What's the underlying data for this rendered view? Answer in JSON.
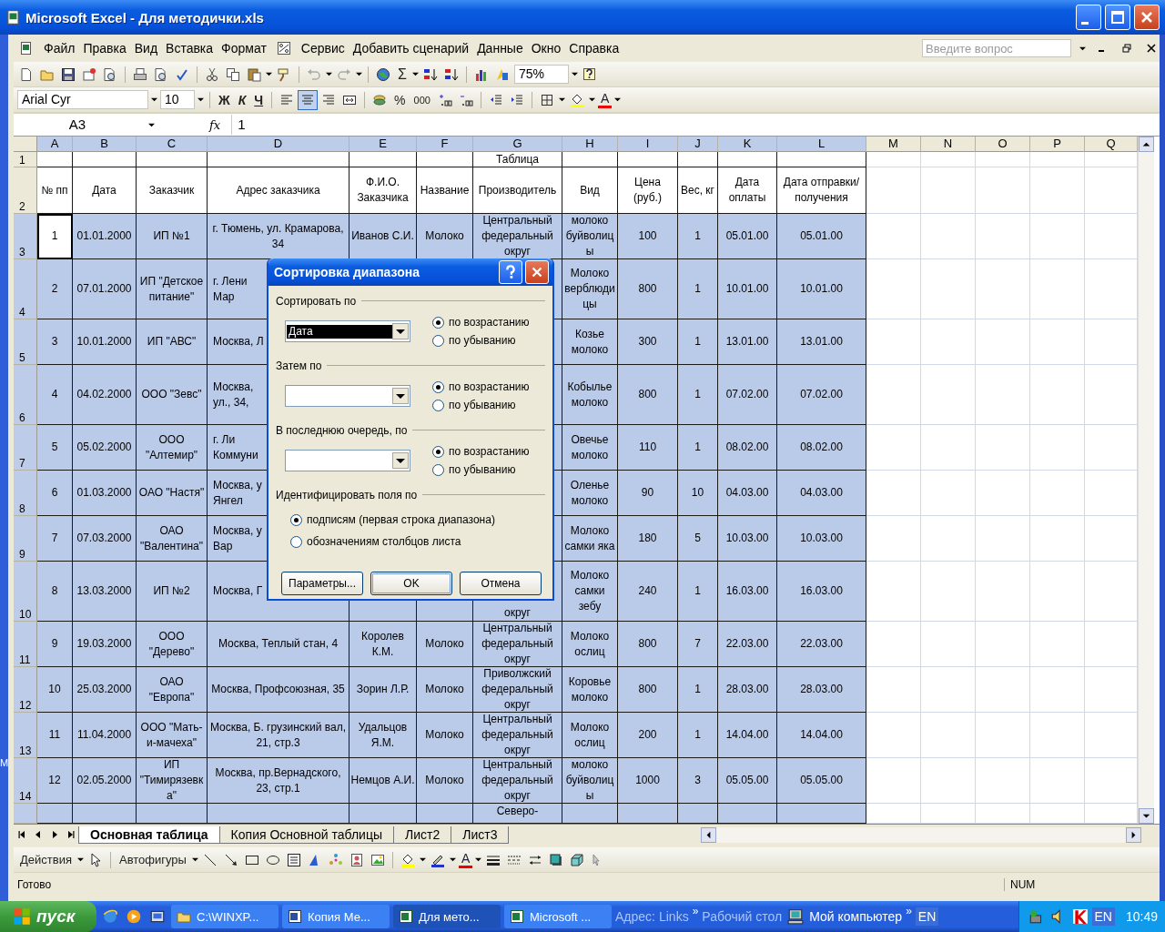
{
  "window": {
    "title": "Microsoft Excel - Для методички.xls"
  },
  "menu": [
    {
      "label": "Файл"
    },
    {
      "label": "Правка"
    },
    {
      "label": "Вид"
    },
    {
      "label": "Вставка"
    },
    {
      "label": "Формат"
    },
    {
      "label": "Сервис",
      "kind": "icon"
    },
    {
      "label": "Добавить сценарий"
    },
    {
      "label": "Данные"
    },
    {
      "label": "Окно"
    },
    {
      "label": "Справка"
    }
  ],
  "help_search": {
    "placeholder": "Введите вопрос"
  },
  "standard_toolbar": {
    "sum": "Σ",
    "zoom": "75%"
  },
  "format_toolbar": {
    "font": "Arial Cyr",
    "size": "10",
    "styles": [
      "Ж",
      "К",
      "Ч"
    ],
    "alignment": [
      {
        "kind": "left",
        "selected": false
      },
      {
        "kind": "center",
        "selected": true
      },
      {
        "kind": "right",
        "selected": false
      },
      {
        "kind": "merge",
        "selected": false
      }
    ],
    "percent": "%",
    "thousands": "000",
    "font_color": "A"
  },
  "formula_bar": {
    "name_box": "A3",
    "fx": "fx",
    "value": "1"
  },
  "sheet": {
    "columns": [
      {
        "label": "A",
        "selected": true
      },
      {
        "label": "B",
        "selected": true
      },
      {
        "label": "C",
        "selected": true
      },
      {
        "label": "D",
        "selected": true
      },
      {
        "label": "E",
        "selected": true
      },
      {
        "label": "F",
        "selected": true
      },
      {
        "label": "G",
        "selected": true
      },
      {
        "label": "H",
        "selected": true
      },
      {
        "label": "I",
        "selected": true
      },
      {
        "label": "J",
        "selected": true
      },
      {
        "label": "K",
        "selected": true
      },
      {
        "label": "L",
        "selected": true
      },
      {
        "label": "M",
        "selected": false
      },
      {
        "label": "N",
        "selected": false
      },
      {
        "label": "O",
        "selected": false
      },
      {
        "label": "P",
        "selected": false
      },
      {
        "label": "Q",
        "selected": false
      }
    ],
    "rows": [
      {
        "number": "1",
        "selected": false,
        "active": false,
        "cells": {
          "g": "Таблица"
        }
      },
      {
        "number": "2",
        "selected": false,
        "active": false,
        "cells": {
          "a": "№ пп",
          "b": "Дата",
          "c": "Заказчик",
          "d": "Адрес заказчика",
          "e": "Ф.И.О. Заказчика",
          "f": "Название",
          "g": "Производитель",
          "h": "Вид",
          "i": "Цена (руб.)",
          "j": "Вес, кг",
          "k": "Дата оплаты",
          "l": "Дата отправки/получения"
        }
      },
      {
        "number": "3",
        "selected": true,
        "active": true,
        "cells": {
          "a": "1",
          "b": "01.01.2000",
          "c": "ИП №1",
          "d": "г. Тюмень, ул. Крамарова, 34",
          "e": "Иванов С.И.",
          "f": "Молоко",
          "g": "Центральный федеральный округ",
          "h": "молоко буйволицы",
          "i": "100",
          "j": "1",
          "k": "05.01.00",
          "l": "05.01.00"
        }
      },
      {
        "number": "4",
        "selected": true,
        "active": false,
        "cells": {
          "a": "2",
          "b": "07.01.2000",
          "c": "ИП \"Детское питание\"",
          "d": "г. Лени\nМар",
          "h": "Молоко верблюдицы",
          "i": "800",
          "j": "1",
          "k": "10.01.00",
          "l": "10.01.00"
        }
      },
      {
        "number": "5",
        "selected": true,
        "active": false,
        "cells": {
          "a": "3",
          "b": "10.01.2000",
          "c": "ИП \"АВС\"",
          "d": "Москва, Л",
          "h": "Козье молоко",
          "i": "300",
          "j": "1",
          "k": "13.01.00",
          "l": "13.01.00"
        }
      },
      {
        "number": "6",
        "selected": true,
        "active": false,
        "cells": {
          "a": "4",
          "b": "04.02.2000",
          "c": "ООО \"Зевс\"",
          "d": "Москва, \nул., 34,",
          "h": "Кобылье молоко",
          "i": "800",
          "j": "1",
          "k": "07.02.00",
          "l": "07.02.00"
        }
      },
      {
        "number": "7",
        "selected": true,
        "active": false,
        "cells": {
          "a": "5",
          "b": "05.02.2000",
          "c": "ООО \"Алтемир\"",
          "d": "г. Ли\nКоммуни",
          "h": "Овечье молоко",
          "i": "110",
          "j": "1",
          "k": "08.02.00",
          "l": "08.02.00"
        }
      },
      {
        "number": "8",
        "selected": true,
        "active": false,
        "cells": {
          "a": "6",
          "b": "01.03.2000",
          "c": "ОАО \"Настя\"",
          "d": "Москва, у\nЯнгел",
          "h": "Оленье молоко",
          "i": "90",
          "j": "10",
          "k": "04.03.00",
          "l": "04.03.00"
        }
      },
      {
        "number": "9",
        "selected": true,
        "active": false,
        "cells": {
          "a": "7",
          "b": "07.03.2000",
          "c": "ОАО \"Валентина\"",
          "d": "Москва, у\nВар",
          "h": "Молоко самки яка",
          "i": "180",
          "j": "5",
          "k": "10.03.00",
          "l": "10.03.00"
        }
      },
      {
        "number": "10",
        "selected": true,
        "active": false,
        "cells": {
          "a": "8",
          "b": "13.03.2000",
          "c": "ИП №2",
          "d": "Москва, Г",
          "g": "округ",
          "h": "Молоко самки зебу",
          "i": "240",
          "j": "1",
          "k": "16.03.00",
          "l": "16.03.00"
        }
      },
      {
        "number": "11",
        "selected": true,
        "active": false,
        "cells": {
          "a": "9",
          "b": "19.03.2000",
          "c": "ООО \"Дерево\"",
          "d": "Москва, Теплый стан, 4",
          "e": "Королев К.М.",
          "f": "Молоко",
          "g": "Центральный федеральный округ",
          "h": "Молоко ослиц",
          "i": "800",
          "j": "7",
          "k": "22.03.00",
          "l": "22.03.00"
        }
      },
      {
        "number": "12",
        "selected": true,
        "active": false,
        "cells": {
          "a": "10",
          "b": "25.03.2000",
          "c": "ОАО \"Европа\"",
          "d": "Москва, Профсоюзная, 35",
          "e": "Зорин Л.Р.",
          "f": "Молоко",
          "g": "Приволжский федеральный округ",
          "h": "Коровье молоко",
          "i": "800",
          "j": "1",
          "k": "28.03.00",
          "l": "28.03.00"
        }
      },
      {
        "number": "13",
        "selected": true,
        "active": false,
        "cells": {
          "a": "11",
          "b": "11.04.2000",
          "c": "ООО \"Мать-и-мачеха\"",
          "d": "Москва, Б. грузинский вал, 21, стр.3",
          "e": "Удальцов Я.М.",
          "f": "Молоко",
          "g": "Центральный федеральный округ",
          "h": "Молоко ослиц",
          "i": "200",
          "j": "1",
          "k": "14.04.00",
          "l": "14.04.00"
        }
      },
      {
        "number": "14",
        "selected": true,
        "active": false,
        "cells": {
          "a": "12",
          "b": "02.05.2000",
          "c": "ИП \"Тимирязевка\"",
          "d": "Москва, пр.Вернадского, 23, стр.1",
          "e": "Немцов А.И.",
          "f": "Молоко",
          "g": "Центральный федеральный округ",
          "h": "молоко буйволицы",
          "i": "1000",
          "j": "3",
          "k": "05.05.00",
          "l": "05.05.00"
        }
      },
      {
        "selected": true,
        "active": false,
        "cells": {
          "g": "Северо-"
        }
      }
    ]
  },
  "sheet_tabs": [
    {
      "label": "Основная таблица",
      "selected": true
    },
    {
      "label": "Копия Основной таблицы",
      "selected": false
    },
    {
      "label": "Лист2",
      "selected": false
    },
    {
      "label": "Лист3",
      "selected": false
    }
  ],
  "drawing_toolbar": {
    "actions": "Действия",
    "autoshapes": "Автофигуры",
    "font_color": "A"
  },
  "status_bar": {
    "status": "Готово",
    "num": "NUM"
  },
  "dialog": {
    "title": "Сортировка диапазона",
    "sections": [
      {
        "label": "Сортировать по",
        "value": "Дата",
        "options": [
          {
            "label": "по возрастанию",
            "selected": true
          },
          {
            "label": "по убыванию",
            "selected": false
          }
        ]
      },
      {
        "label": "Затем по",
        "options": [
          {
            "label": "по возрастанию",
            "selected": true
          },
          {
            "label": "по убыванию",
            "selected": false
          }
        ]
      },
      {
        "label": "В последнюю очередь, по",
        "options": [
          {
            "label": "по возрастанию",
            "selected": true
          },
          {
            "label": "по убыванию",
            "selected": false
          }
        ]
      }
    ],
    "identify": {
      "label": "Идентифицировать поля по",
      "options": [
        {
          "label": "подписям (первая строка диапазона)",
          "selected": true
        },
        {
          "label": "обозначениям столбцов листа",
          "selected": false
        }
      ]
    },
    "buttons": [
      {
        "label": "Параметры...",
        "default": false
      },
      {
        "label": "OK",
        "default": true
      },
      {
        "label": "Отмена",
        "default": false
      }
    ]
  },
  "desktop_fragment": "M",
  "taskbar": {
    "start": "пуск",
    "tasks": [
      {
        "label": "C:\\WINXP...",
        "kind": "folder",
        "selected": false
      },
      {
        "label": "Копия Ме...",
        "kind": "word",
        "selected": false
      },
      {
        "label": "Для мето...",
        "kind": "excel",
        "selected": true
      },
      {
        "label": "Microsoft ...",
        "kind": "excel",
        "selected": false
      }
    ],
    "address": "Адрес:",
    "links": "Links",
    "chevron": "»",
    "desktop": "Рабочий стол",
    "computer": "Мой компьютер",
    "chevron2": "»",
    "lang": "EN",
    "tray_lang": "EN",
    "clock": "10:49"
  }
}
